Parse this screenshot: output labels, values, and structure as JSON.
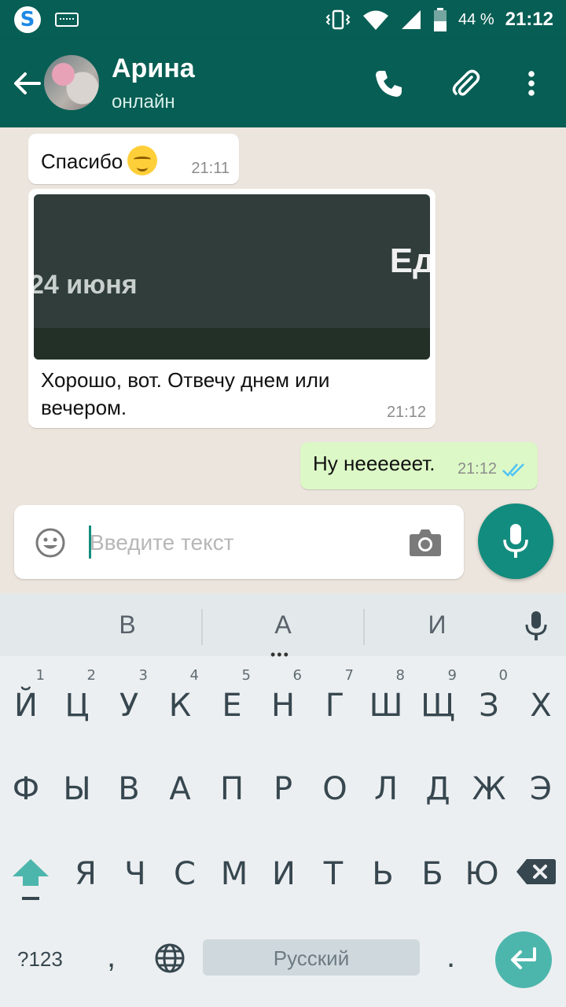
{
  "status_bar": {
    "battery_percent": "44 %",
    "time": "21:12"
  },
  "header": {
    "contact_name": "Арина",
    "contact_status": "онлайн"
  },
  "messages": [
    {
      "direction": "incoming",
      "text": "Спасибо",
      "time": "21:11"
    },
    {
      "direction": "incoming",
      "image_text_left": "24 июня",
      "image_text_right": "Ед",
      "caption": "Хорошо, вот. Отвечу днем или вечером.",
      "time": "21:12"
    },
    {
      "direction": "outgoing",
      "text": "Ну неееееет.",
      "time": "21:12"
    }
  ],
  "composer": {
    "placeholder": "Введите текст"
  },
  "keyboard": {
    "suggestions": [
      "В",
      "А",
      "И"
    ],
    "row1": [
      {
        "ch": "Й",
        "num": "1"
      },
      {
        "ch": "Ц",
        "num": "2"
      },
      {
        "ch": "У",
        "num": "3"
      },
      {
        "ch": "К",
        "num": "4"
      },
      {
        "ch": "Е",
        "num": "5"
      },
      {
        "ch": "Н",
        "num": "6"
      },
      {
        "ch": "Г",
        "num": "7"
      },
      {
        "ch": "Ш",
        "num": "8"
      },
      {
        "ch": "Щ",
        "num": "9"
      },
      {
        "ch": "З",
        "num": "0"
      },
      {
        "ch": "Х",
        "num": ""
      }
    ],
    "row2": [
      "Ф",
      "Ы",
      "В",
      "А",
      "П",
      "Р",
      "О",
      "Л",
      "Д",
      "Ж",
      "Э"
    ],
    "row3": [
      "Я",
      "Ч",
      "С",
      "М",
      "И",
      "Т",
      "Ь",
      "Б",
      "Ю"
    ],
    "symbols_label": "?123",
    "comma": ",",
    "space_label": "Русский",
    "period": "."
  },
  "colors": {
    "header": "#075E54",
    "accent": "#128C7E",
    "outgoing_bubble": "#DCF8C6",
    "chat_bg": "#ECE5DD",
    "read_ticks": "#4FC3F7"
  }
}
